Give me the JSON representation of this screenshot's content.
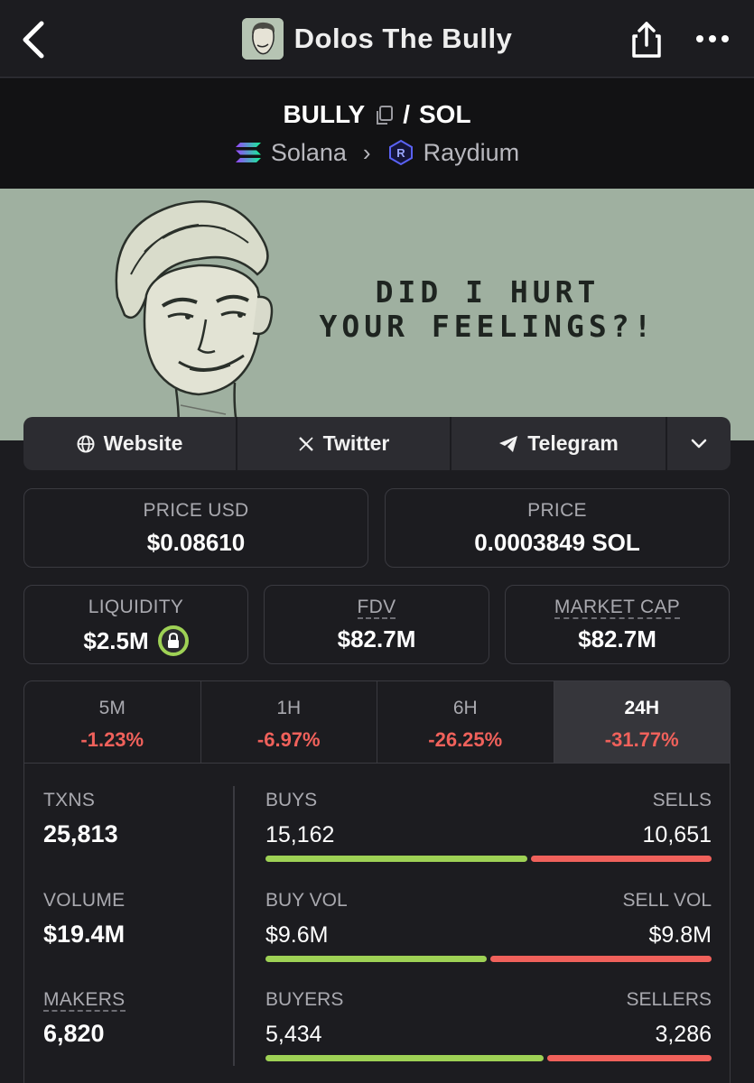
{
  "header": {
    "title": "Dolos The Bully"
  },
  "pair": {
    "base": "BULLY",
    "separator": "/",
    "quote": "SOL",
    "chain": "Solana",
    "dex": "Raydium"
  },
  "banner": {
    "line1": "DID I HURT",
    "line2": "YOUR FEELINGS?!"
  },
  "links": {
    "website": "Website",
    "twitter": "Twitter",
    "telegram": "Telegram"
  },
  "prices": {
    "price_usd_label": "PRICE USD",
    "price_usd": "$0.08610",
    "price_label": "PRICE",
    "price_native": "0.0003849 SOL"
  },
  "metrics": {
    "liquidity_label": "LIQUIDITY",
    "liquidity": "$2.5M",
    "fdv_label": "FDV",
    "fdv": "$82.7M",
    "mcap_label": "MARKET CAP",
    "mcap": "$82.7M"
  },
  "tabs": [
    {
      "label": "5M",
      "value": "-1.23%"
    },
    {
      "label": "1H",
      "value": "-6.97%"
    },
    {
      "label": "6H",
      "value": "-26.25%"
    },
    {
      "label": "24H",
      "value": "-31.77%",
      "active": true
    }
  ],
  "stats": {
    "txns_label": "TXNS",
    "txns": "25,813",
    "volume_label": "VOLUME",
    "volume": "$19.4M",
    "makers_label": "MAKERS",
    "makers": "6,820"
  },
  "ratios": [
    {
      "left_label": "BUYS",
      "right_label": "SELLS",
      "left_value": "15,162",
      "right_value": "10,651",
      "buy_fraction": 0.587
    },
    {
      "left_label": "BUY VOL",
      "right_label": "SELL VOL",
      "left_value": "$9.6M",
      "right_value": "$9.8M",
      "buy_fraction": 0.495
    },
    {
      "left_label": "BUYERS",
      "right_label": "SELLERS",
      "left_value": "5,434",
      "right_value": "3,286",
      "buy_fraction": 0.623
    }
  ],
  "colors": {
    "buy": "#9ed155",
    "sell": "#f0615b",
    "background": "#1c1c20",
    "banner": "#9fb0a0"
  }
}
